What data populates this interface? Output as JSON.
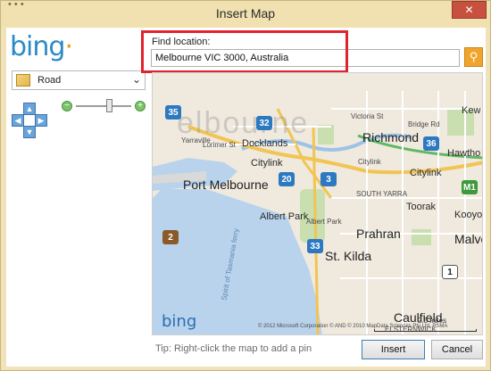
{
  "window": {
    "title": "Insert Map",
    "ghost_title": "• • •",
    "close_label": "✕"
  },
  "left_panel": {
    "logo_text": "bing",
    "map_style": "Road"
  },
  "find": {
    "label": "Find location:",
    "value": "Melbourne VIC 3000, Australia"
  },
  "map": {
    "watermark_text": "elbourne",
    "logo_text": "bing",
    "copyright": "© 2012 Microsoft Corporation   © AND  © 2010 MapData Sciences Pty Ltd, PSMA",
    "scale_label": "2.5 miles",
    "labels": [
      {
        "id": "yarraville",
        "text": "Yarraville"
      },
      {
        "id": "lorimer",
        "text": "Lorimer St"
      },
      {
        "id": "docklands",
        "text": "Docklands"
      },
      {
        "id": "victoria",
        "text": "Victoria St"
      },
      {
        "id": "bridge",
        "text": "Bridge Rd"
      },
      {
        "id": "kew",
        "text": "Kew"
      },
      {
        "id": "richmond",
        "text": "Richmond"
      },
      {
        "id": "hawthorn",
        "text": "Hawtho"
      },
      {
        "id": "citylink1",
        "text": "Citylink"
      },
      {
        "id": "citylink2",
        "text": "Citylink"
      },
      {
        "id": "citylink3",
        "text": "Citylink"
      },
      {
        "id": "portmelb",
        "text": "Port Melbourne"
      },
      {
        "id": "southyarra",
        "text": "SOUTH YARRA"
      },
      {
        "id": "toorak",
        "text": "Toorak"
      },
      {
        "id": "kooyong",
        "text": "Kooyon"
      },
      {
        "id": "albertpark1",
        "text": "Albert Park"
      },
      {
        "id": "albertpark2",
        "text": "Albert Park"
      },
      {
        "id": "prahran",
        "text": "Prahran"
      },
      {
        "id": "malvern",
        "text": "Malve"
      },
      {
        "id": "stkilda",
        "text": "St. Kilda"
      },
      {
        "id": "caulfield",
        "text": "Caulfield"
      },
      {
        "id": "elsternwick",
        "text": "ELSTERNWICK"
      },
      {
        "id": "spirit",
        "text": "Spirit of Tasmania ferry"
      }
    ],
    "shields": [
      {
        "id": "s35",
        "text": "35"
      },
      {
        "id": "s32",
        "text": "32"
      },
      {
        "id": "s36",
        "text": "36"
      },
      {
        "id": "s20",
        "text": "20"
      },
      {
        "id": "s3",
        "text": "3"
      },
      {
        "id": "sm1",
        "text": "M1"
      },
      {
        "id": "s2",
        "text": "2"
      },
      {
        "id": "s33",
        "text": "33"
      },
      {
        "id": "s1",
        "text": "1"
      }
    ]
  },
  "footer": {
    "tip": "Tip: Right-click the map to add a pin",
    "insert_label": "Insert",
    "cancel_label": "Cancel"
  },
  "colors": {
    "frame": "#f0e2b9",
    "highlight": "#e0232c",
    "water": "#b9d3ec",
    "park": "#c9dfb0",
    "freeway": "#f1c453"
  }
}
